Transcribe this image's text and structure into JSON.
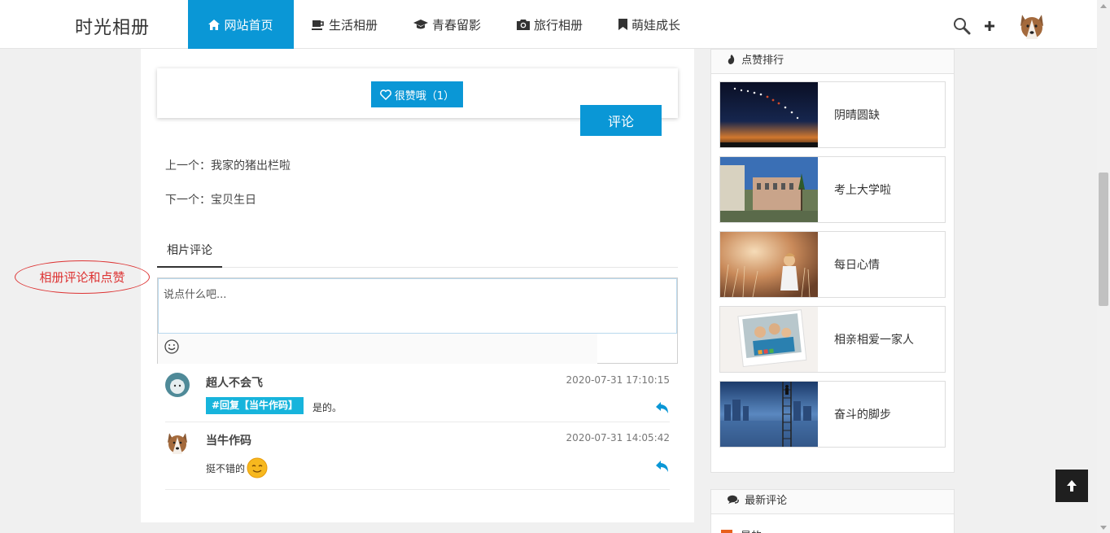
{
  "header": {
    "brand": "时光相册",
    "nav": [
      {
        "label": "网站首页",
        "icon": "home-icon",
        "active": true
      },
      {
        "label": "生活相册",
        "icon": "coffee-cup-icon",
        "active": false
      },
      {
        "label": "青春留影",
        "icon": "graduation-cap-icon",
        "active": false
      },
      {
        "label": "旅行相册",
        "icon": "camera-icon",
        "active": false
      },
      {
        "label": "萌娃成长",
        "icon": "bookmark-icon",
        "active": false
      }
    ],
    "icons": [
      "search-icon",
      "plus-icon",
      "user-avatar"
    ]
  },
  "main": {
    "like_button": "很赞哦（1）",
    "prev": "上一个：我家的猪出栏啦",
    "next": "下一个：宝贝生日",
    "tab": "相片评论",
    "comment_placeholder": "说点什么吧...",
    "submit_label": "评论",
    "comments": [
      {
        "name": "超人不会飞",
        "time": "2020-07-31 17:10:15",
        "reply_tag": "#回复【当牛作码】",
        "text": "是的。"
      },
      {
        "name": "当牛作码",
        "time": "2020-07-31 14:05:42",
        "reply_tag": "",
        "text": "挺不错的"
      }
    ]
  },
  "annotation": "相册评论和点赞",
  "sidebar": {
    "rank_title": "点赞排行",
    "rank": [
      {
        "title": "阴晴圆缺"
      },
      {
        "title": "考上大学啦"
      },
      {
        "title": "每日心情"
      },
      {
        "title": "相亲相爱一家人"
      },
      {
        "title": "奋斗的脚步"
      }
    ],
    "latest_title": "最新评论",
    "latest_first": "是的"
  },
  "colors": {
    "accent": "#0a97d6",
    "tag": "#17b4dc",
    "annotation": "#dd3333"
  }
}
